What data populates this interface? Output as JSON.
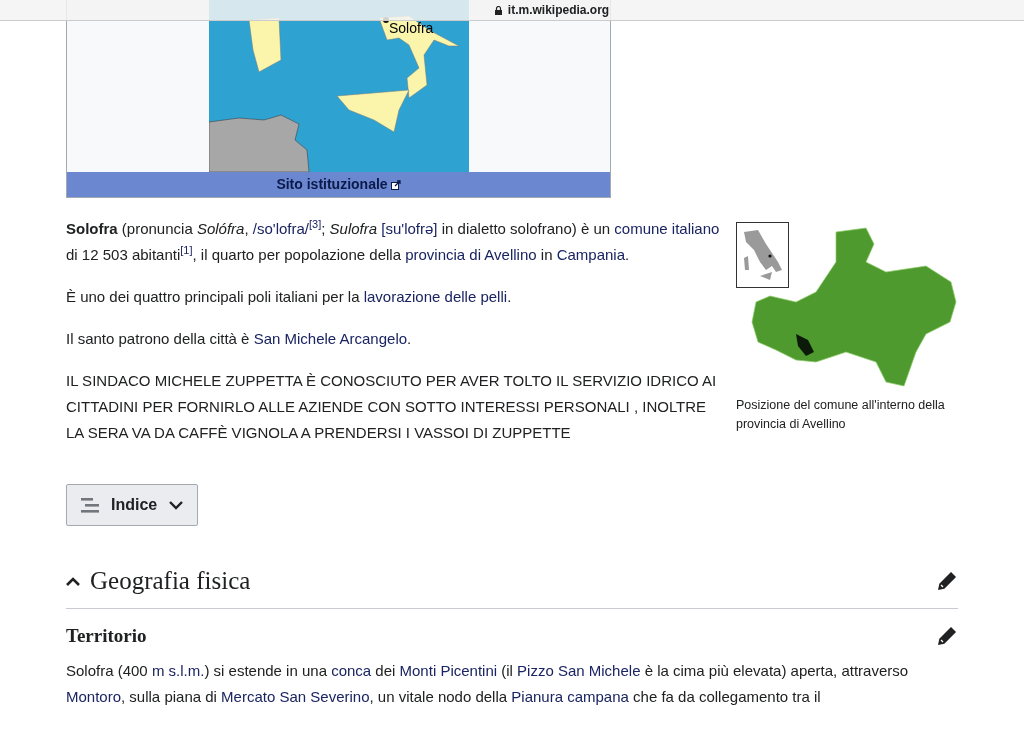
{
  "browser_bar": {
    "address": "it.m.wikipedia.org"
  },
  "infobox": {
    "map_label": "Solofra",
    "caption_link": "Sito istituzionale"
  },
  "intro_paragraphs": [
    [
      {
        "kind": "text",
        "text": "**Solofra** (pronuncia *Solófra*, "
      },
      {
        "kind": "link",
        "text": "/so'lofra/"
      },
      {
        "kind": "ref",
        "text": "[3]"
      },
      {
        "kind": "text",
        "text": "; *Sulofra* "
      },
      {
        "kind": "link",
        "text": "[su'lofrə]"
      },
      {
        "kind": "text",
        "text": " in dialetto solofrano) è un "
      },
      {
        "kind": "link",
        "text": "comune"
      },
      {
        "kind": "link",
        "text": "italiano"
      },
      {
        "kind": "text",
        "text": " di 12 503 abitanti"
      },
      {
        "kind": "ref",
        "text": "[1]"
      },
      {
        "kind": "text",
        "text": ", il quarto per popolazione della "
      },
      {
        "kind": "link",
        "text": "provincia di Avellino"
      },
      {
        "kind": "text",
        "text": " in "
      },
      {
        "kind": "link",
        "text": "Campania"
      },
      {
        "kind": "text",
        "text": "."
      }
    ],
    [
      {
        "kind": "text",
        "text": "È uno dei quattro principali poli italiani per la "
      },
      {
        "kind": "link",
        "text": "lavorazione delle pelli"
      },
      {
        "kind": "text",
        "text": "."
      }
    ],
    [
      {
        "kind": "text",
        "text": "Il santo patrono della città è "
      },
      {
        "kind": "link",
        "text": "San Michele Arcangelo"
      },
      {
        "kind": "text",
        "text": "."
      }
    ],
    [
      {
        "kind": "text",
        "text": "IL SINDACO MICHELE ZUPPETTA È CONOSCIUTO PER AVER TOLTO IL SERVIZIO IDRICO AI CITTADINI PER FORNIRLO ALLE AZIENDE CON SOTTO INTERESSI PERSONALI , INOLTRE LA SERA VA DA CAFFÈ VIGNOLA A PRENDERSI I VASSOI DI ZUPPETTE"
      }
    ]
  ],
  "locator": {
    "caption": "Posizione del comune all'interno della provincia di Avellino"
  },
  "toc_button": {
    "label": "Indice",
    "expanded": false
  },
  "sections": [
    {
      "title": "Geografia fisica",
      "expanded": true
    }
  ],
  "subsections": [
    {
      "title": "Territorio",
      "paragraph": [
        {
          "kind": "text",
          "text": "Solofra (400 "
        },
        {
          "kind": "link",
          "text": "m s.l.m."
        },
        {
          "kind": "text",
          "text": ") si estende in una "
        },
        {
          "kind": "link",
          "text": "conca"
        },
        {
          "kind": "text",
          "text": " dei "
        },
        {
          "kind": "link",
          "text": "Monti Picentini"
        },
        {
          "kind": "text",
          "text": " (il "
        },
        {
          "kind": "link",
          "text": "Pizzo San Michele"
        },
        {
          "kind": "text",
          "text": " è la cima più elevata) aperta, attraverso "
        },
        {
          "kind": "link",
          "text": "Montoro"
        },
        {
          "kind": "text",
          "text": ", sulla piana di "
        },
        {
          "kind": "link",
          "text": "Mercato San Severino"
        },
        {
          "kind": "text",
          "text": ", un vitale nodo della "
        },
        {
          "kind": "link",
          "text": "Pianura campana"
        },
        {
          "kind": "text",
          "text": " che fa da collegamento tra il"
        }
      ]
    }
  ]
}
